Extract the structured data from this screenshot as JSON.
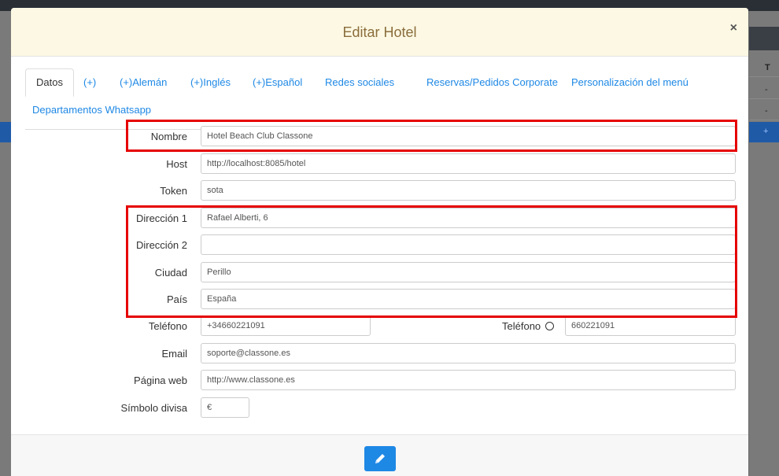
{
  "background": {
    "right_header": "T",
    "right_rows": [
      "-",
      "-"
    ],
    "right_blue": "+"
  },
  "modal": {
    "title": "Editar Hotel",
    "close": "×"
  },
  "tabs": [
    {
      "label": "Datos",
      "active": true
    },
    {
      "label": "(+)"
    },
    {
      "label": "(+)Alemán"
    },
    {
      "label": "(+)Inglés"
    },
    {
      "label": "(+)Español"
    },
    {
      "label": "Redes sociales"
    },
    {
      "label": "Reservas/Pedidos Corporate"
    },
    {
      "label": "Personalización del menú"
    },
    {
      "label": "Departamentos Whatsapp"
    }
  ],
  "form": {
    "nombre": {
      "label": "Nombre",
      "value": "Hotel Beach Club Classone"
    },
    "host": {
      "label": "Host",
      "value": "http://localhost:8085/hotel"
    },
    "token": {
      "label": "Token",
      "value": "sota"
    },
    "direccion1": {
      "label": "Dirección 1",
      "value": "Rafael Alberti, 6"
    },
    "direccion2": {
      "label": "Dirección 2",
      "value": ""
    },
    "ciudad": {
      "label": "Ciudad",
      "value": "Perillo"
    },
    "pais": {
      "label": "País",
      "value": "España"
    },
    "telefono": {
      "label": "Teléfono",
      "value": "+34660221091"
    },
    "telefono_wa": {
      "label": "Teléfono",
      "value": "660221091"
    },
    "email": {
      "label": "Email",
      "value": "soporte@classone.es"
    },
    "web": {
      "label": "Página web",
      "value": "http://www.classone.es"
    },
    "divisa": {
      "label": "Símbolo divisa",
      "value": "€"
    }
  },
  "colors": {
    "header_bg": "#fcf8e3",
    "title": "#8a6d3b",
    "link": "#1e88e5",
    "highlight": "#e60000",
    "button": "#1e88e5"
  },
  "icons": {
    "whatsapp": "whatsapp-icon",
    "edit": "pencil-icon"
  }
}
